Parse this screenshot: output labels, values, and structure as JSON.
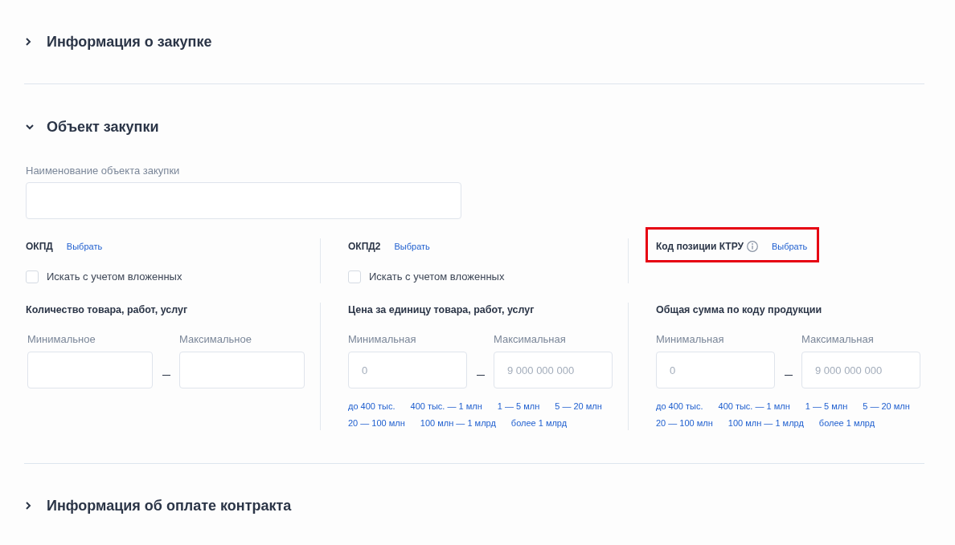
{
  "sections": [
    {
      "title": "Информация о закупке",
      "expanded": false
    },
    {
      "title": "Объект закупки",
      "expanded": true,
      "name_field": {
        "label": "Наименование объекта закупки"
      },
      "classifiers": [
        {
          "label": "ОКПД",
          "info": false,
          "link": "Выбрать",
          "highlighted": false,
          "checkbox": {
            "label": "Искать с учетом вложенных",
            "checked": false
          }
        },
        {
          "label": "ОКПД2",
          "info": false,
          "link": "Выбрать",
          "highlighted": false,
          "checkbox": {
            "label": "Искать с учетом вложенных",
            "checked": false
          }
        },
        {
          "label": "Код позиции КТРУ",
          "info": true,
          "link": "Выбрать",
          "highlighted": true
        }
      ],
      "ranges": [
        {
          "title": "Количество товара, работ, услуг",
          "min": {
            "label": "Минимальное"
          },
          "max": {
            "label": "Максимальное"
          }
        },
        {
          "title": "Цена за единицу товара, работ, услуг",
          "min": {
            "label": "Минимальная",
            "placeholder": "0"
          },
          "max": {
            "label": "Максимальная",
            "placeholder": "9 000 000 000"
          },
          "presets": [
            "до 400 тыс.",
            "400 тыс. — 1 млн",
            "1 — 5 млн",
            "5 — 20 млн",
            "20 — 100 млн",
            "100 млн — 1 млрд",
            "более 1 млрд"
          ]
        },
        {
          "title": "Общая сумма по коду продукции",
          "min": {
            "label": "Минимальная",
            "placeholder": "0"
          },
          "max": {
            "label": "Максимальная",
            "placeholder": "9 000 000 000"
          },
          "presets": [
            "до 400 тыс.",
            "400 тыс. — 1 млн",
            "1 — 5 млн",
            "5 — 20 млн",
            "20 — 100 млн",
            "100 млн — 1 млрд",
            "более 1 млрд"
          ]
        }
      ]
    },
    {
      "title": "Информация об оплате контракта",
      "expanded": false
    }
  ]
}
